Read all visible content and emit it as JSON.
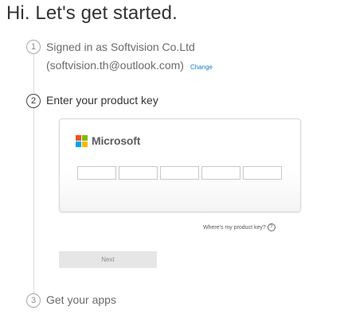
{
  "page": {
    "title": "Hi. Let's get started."
  },
  "steps": [
    {
      "number": "1",
      "line1": "Signed in as Softvision Co.Ltd",
      "line2": "(softvision.th@outlook.com)",
      "link": "Change"
    },
    {
      "number": "2",
      "label": "Enter your product key"
    },
    {
      "number": "3",
      "label": "Get your apps"
    }
  ],
  "product_key": {
    "brand": "Microsoft",
    "segments": [
      "",
      "",
      "",
      "",
      ""
    ],
    "help_link": "Where's my product key?",
    "help_icon": "question-circle-icon"
  },
  "actions": {
    "next_label": "Next"
  },
  "colors": {
    "link": "#1a7fd1",
    "ms_red": "#f25022",
    "ms_green": "#7fba00",
    "ms_blue": "#00a4ef",
    "ms_yellow": "#ffb900",
    "button_bg": "#e6e6e6"
  }
}
